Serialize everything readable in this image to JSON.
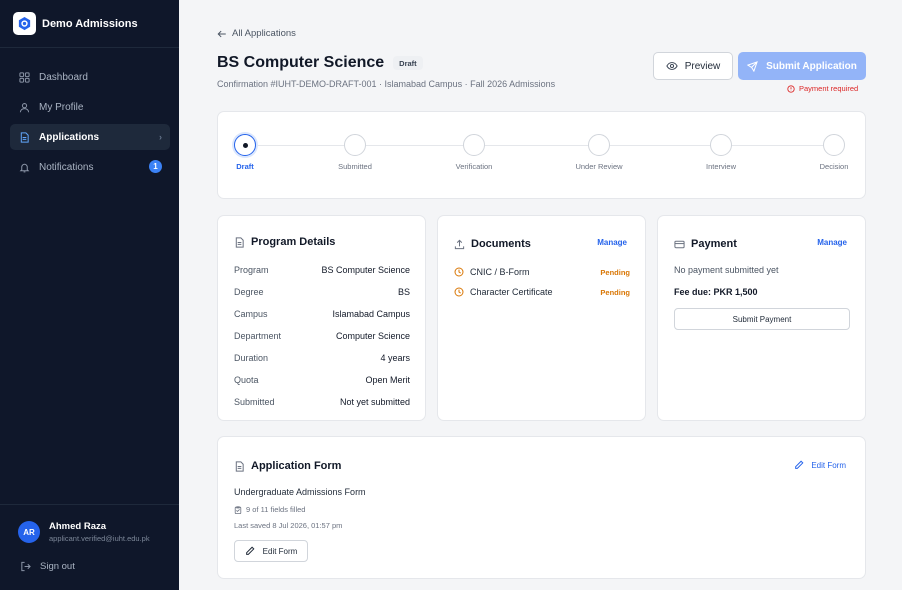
{
  "brand": {
    "name": "Demo Admissions"
  },
  "nav": {
    "items": [
      {
        "label": "Dashboard",
        "icon": "dashboard-icon"
      },
      {
        "label": "My Profile",
        "icon": "user-icon"
      },
      {
        "label": "Applications",
        "icon": "document-icon",
        "active": true
      },
      {
        "label": "Notifications",
        "icon": "bell-icon",
        "badge": "1"
      }
    ]
  },
  "user": {
    "initials": "AR",
    "name": "Ahmed Raza",
    "email": "applicant.verified@iuht.edu.pk",
    "signout_label": "Sign out"
  },
  "header": {
    "back_label": "All Applications",
    "title": "BS Computer Science",
    "status_badge": "Draft",
    "subtitle": "Confirmation #IUHT-DEMO-DRAFT-001 · Islamabad Campus · Fall 2026 Admissions",
    "preview_label": "Preview",
    "submit_label": "Submit Application",
    "payment_warning": "Payment required"
  },
  "progress": {
    "steps": [
      "Draft",
      "Submitted",
      "Verification",
      "Under Review",
      "Interview",
      "Decision"
    ],
    "current": 0
  },
  "program": {
    "title": "Program Details",
    "rows": [
      {
        "label": "Program",
        "value": "BS Computer Science"
      },
      {
        "label": "Degree",
        "value": "BS"
      },
      {
        "label": "Campus",
        "value": "Islamabad Campus"
      },
      {
        "label": "Department",
        "value": "Computer Science"
      },
      {
        "label": "Duration",
        "value": "4 years"
      },
      {
        "label": "Quota",
        "value": "Open Merit"
      },
      {
        "label": "Submitted",
        "value": "Not yet submitted"
      }
    ]
  },
  "documents": {
    "title": "Documents",
    "manage_label": "Manage",
    "items": [
      {
        "name": "CNIC / B-Form",
        "status": "Pending"
      },
      {
        "name": "Character Certificate",
        "status": "Pending"
      }
    ]
  },
  "payment": {
    "title": "Payment",
    "manage_label": "Manage",
    "status_text": "No payment submitted yet",
    "fee_due": "Fee due: PKR 1,500",
    "submit_label": "Submit Payment"
  },
  "application_form": {
    "title": "Application Form",
    "edit_link_label": "Edit Form",
    "form_name": "Undergraduate Admissions Form",
    "fields_filled": "9 of 11 fields filled",
    "last_saved": "Last saved 8 Jul 2026, 01:57 pm",
    "edit_button_label": "Edit Form"
  },
  "colors": {
    "sidebar_bg": "#0f172a",
    "accent": "#2563eb",
    "submit_disabled": "#93b4f8",
    "pending": "#d97706",
    "danger": "#dc2626"
  }
}
